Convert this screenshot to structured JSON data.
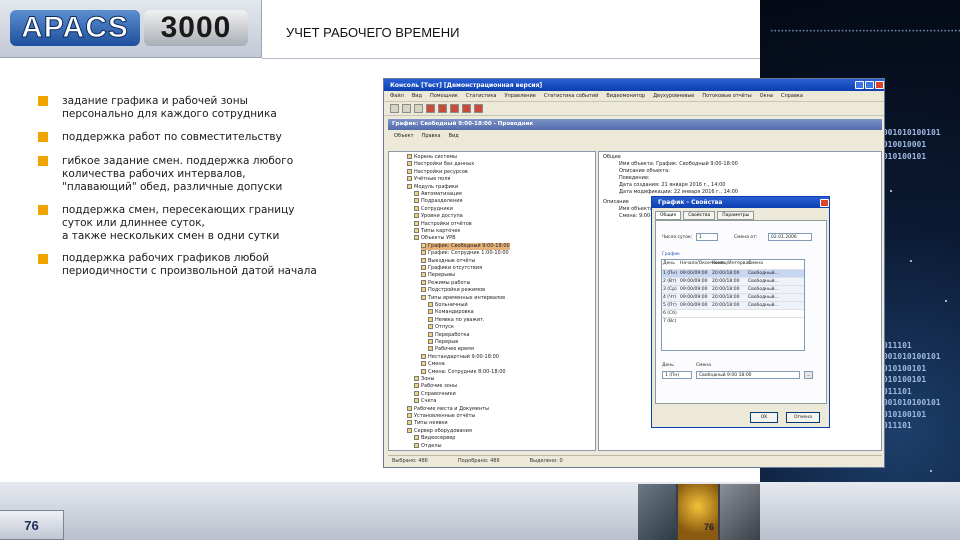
{
  "logo": {
    "brand": "APACS",
    "model": "3000"
  },
  "header": {
    "title": "УЧЕТ РАБОЧЕГО ВРЕМЕНИ"
  },
  "bullets": [
    "задание графика и рабочей зоны\nперсонально для каждого сотрудника",
    "поддержка работ по совместительству",
    "гибкое задание смен. поддержка любого\nколичества рабочих интервалов,\n\"плавающий\" обед, различные допуски",
    "поддержка смен, пересекающих границу\nсуток или длиннее суток,\nа также нескольких смен в одни сутки",
    "поддержка рабочих графиков любой\nпериодичности с произвольной датой начала"
  ],
  "footer": {
    "page_number": "76",
    "photo_page_number": "76"
  },
  "decor": {
    "binary_rows": [
      "0001010100101",
      "1010010001",
      "1010100101",
      "0001010100101",
      "1010010001",
      "1010100101",
      "0001010100101"
    ],
    "binary_rows_lower": [
      "0011101",
      "0001010100101",
      "0010100101",
      "0010100101",
      "0011101",
      "0001010100101",
      "0010100101",
      "0011101"
    ]
  },
  "screenshot": {
    "window_title": "Консоль [Тест] [Демонстрационная версия]",
    "menu": [
      "Файл",
      "Вид",
      "Помощник",
      "Статистика",
      "Управление",
      "Статистика событий",
      "Видеомонитор",
      "Двухуровневые",
      "Потоковые отчёты",
      "Окна",
      "Справка"
    ],
    "subwindow_title": "График: Свободный 9:00-18:00 - Проводник",
    "subwindow_menu": [
      "Объект",
      "Правка",
      "Вид"
    ],
    "tree": [
      "Корень системы",
      "Настройки баз данных",
      "Настройки ресурсов",
      "Учётные поля",
      "Модуль графики",
      "Автоматизация",
      "Подразделения",
      "Сотрудники",
      "Уровни доступа",
      "Настройки отчётов",
      "Типы карточек",
      "Объекты УРВ",
      "График: Свободный 9:00-18:00",
      "График: Сотрудник 1:00-10:00",
      "Выездные отчёты",
      "Графики отсутствия",
      "Перерывы",
      "Режимы работы",
      "Подстройки режимов",
      "Типы временных интервалов",
      "Больничный",
      "Командировка",
      "Неявка по уважит.",
      "Отпуск",
      "Переработка",
      "Перерыв",
      "Рабочее время",
      "Нестандартный 9:00-18:00",
      "Смена",
      "Смена: Сотрудник 8:00-18:00",
      "Зоны",
      "Рабочие зоны",
      "Справочники",
      "Счета",
      "Рабочие места и Документы",
      "Установленные отчёты",
      "Типы неявки",
      "Сервер оборудования",
      "Видеосервер",
      "Отделы"
    ],
    "right_panel": [
      "Общее",
      "Имя объекта: График: Свободный 9:00-18:00",
      "Описание объекта:",
      "Поведение:",
      "Дата создания: 21 января 2016 г., 14:00",
      "Дата модификации: 22 января 2016 г., 14:00",
      "Описание",
      "Имя объекта:",
      "Смена: 9:00-18:00"
    ],
    "status": [
      "Выбрано: 486",
      "Подобрано: 486",
      "Выделено: 0"
    ],
    "dialog": {
      "title": "График - Свойства",
      "tabs": [
        "Общие",
        "Свойства",
        "Параметры"
      ],
      "count_label": "Число суток:",
      "count_value": "1",
      "start_label": "Смена от:",
      "start_value": "02.01.2006",
      "grid_label": "График",
      "columns": [
        "День",
        "Начало/Окончание",
        "Конец/Интервал",
        "Смена"
      ],
      "rows": [
        [
          "1 (Пн)",
          "09:00/09:00",
          "20:00/18:00",
          "Свободный..."
        ],
        [
          "2 (Вт)",
          "09:00/09:00",
          "20:00/18:00",
          "Свободный..."
        ],
        [
          "3 (Ср)",
          "09:00/09:00",
          "20:00/18:00",
          "Свободный..."
        ],
        [
          "4 (Чт)",
          "09:00/09:00",
          "20:00/18:00",
          "Свободный..."
        ],
        [
          "5 (Пт)",
          "09:00/09:00",
          "20:00/18:00",
          "Свободный..."
        ],
        [
          "6 (Сб)",
          "",
          "",
          ""
        ],
        [
          "7 (Вс)",
          "",
          "",
          ""
        ]
      ],
      "day_label": "День",
      "shift_label": "Смена",
      "day_value": "1 (Пн)",
      "shift_value": "Свободный 9:00 18:00",
      "ok": "OK",
      "cancel": "Отмена"
    }
  }
}
